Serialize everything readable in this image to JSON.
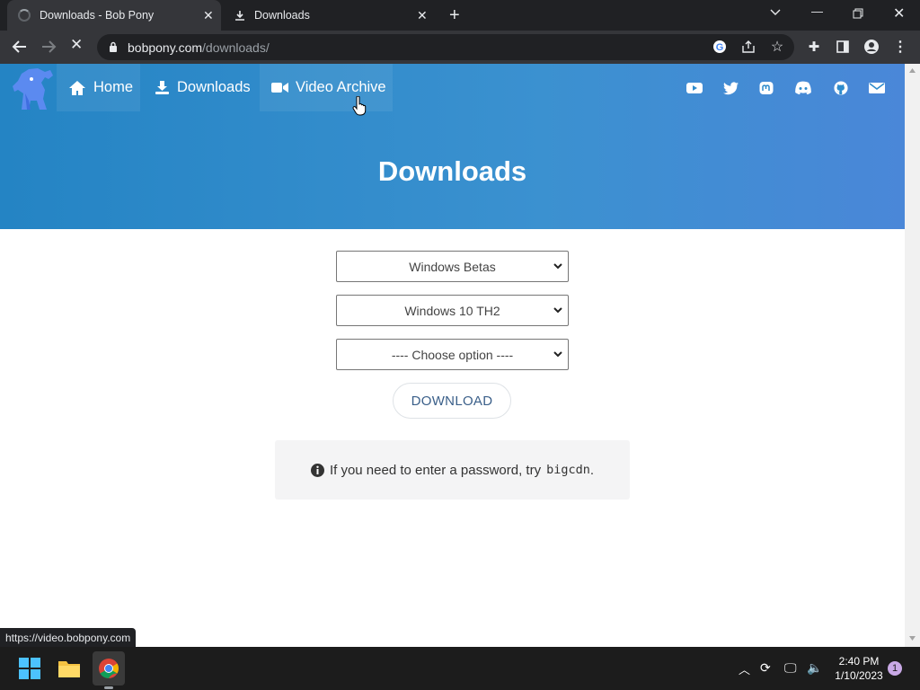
{
  "browser": {
    "tabs": [
      {
        "title": "Downloads - Bob Pony",
        "loading": true,
        "active": true
      },
      {
        "title": "Downloads",
        "icon": "download-icon",
        "active": false
      }
    ],
    "url_host": "bobpony.com",
    "url_path": "/downloads/",
    "status_url": "https://video.bobpony.com"
  },
  "site": {
    "nav": [
      {
        "label": "Home",
        "icon": "home-icon"
      },
      {
        "label": "Downloads",
        "icon": "download-icon"
      },
      {
        "label": "Video Archive",
        "icon": "video-camera-icon"
      }
    ],
    "social_icons": [
      "youtube-icon",
      "twitter-icon",
      "mastodon-icon",
      "discord-icon",
      "github-icon",
      "email-icon"
    ],
    "title": "Downloads",
    "selects": [
      "Windows Betas",
      "Windows 10 TH2",
      "---- Choose option ----"
    ],
    "download_label": "DOWNLOAD",
    "note_text": "If you need to enter a password, try",
    "note_code": "bigcdn",
    "note_end": ".",
    "accent": "#2e8bcc"
  },
  "taskbar": {
    "time": "2:40 PM",
    "date": "1/10/2023",
    "notifications": "1"
  }
}
